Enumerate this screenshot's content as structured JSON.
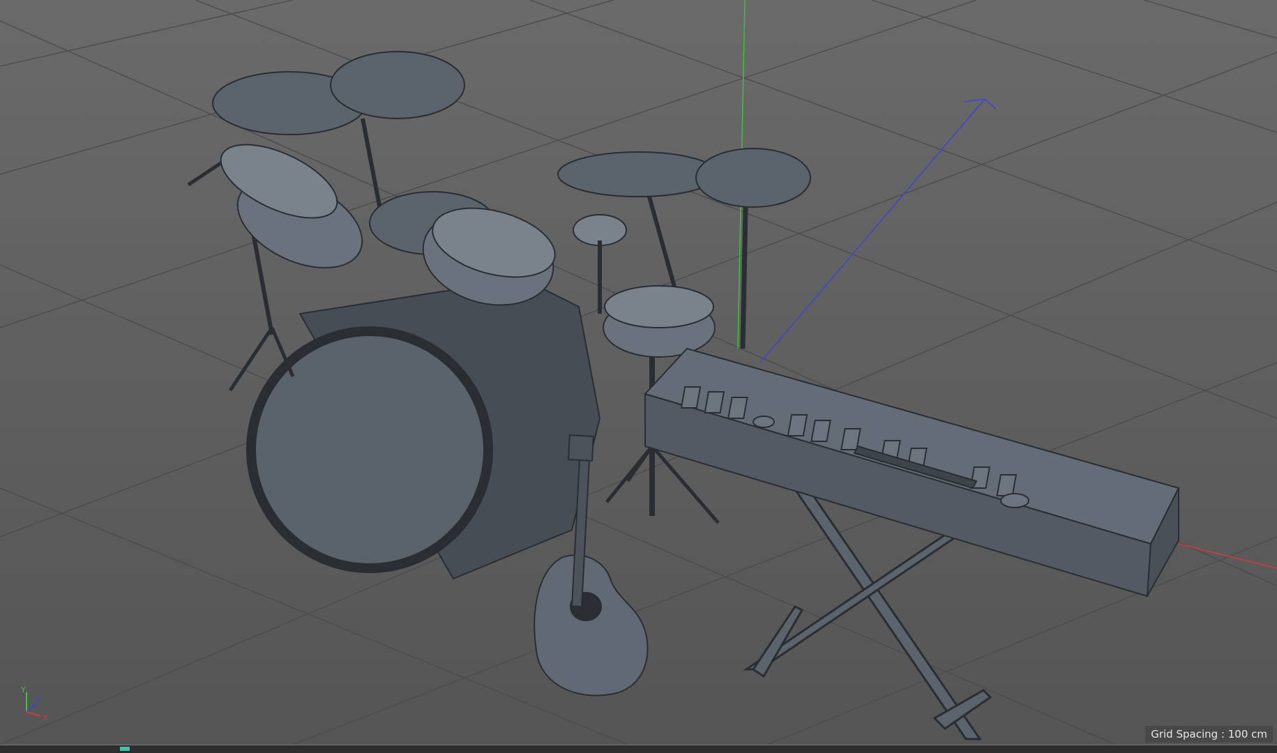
{
  "viewport": {
    "grid_spacing_label": "Grid Spacing : 100 cm"
  },
  "axis_widget": {
    "y_label": "Y",
    "z_label": "Z",
    "x_label": "X"
  },
  "scene": {
    "objects": [
      "drum-kit",
      "acoustic-guitar",
      "keyboard-synth",
      "keyboard-stand"
    ]
  },
  "colors": {
    "x_axis": "#d23b3b",
    "y_axis": "#39c339",
    "z_axis": "#3f44d6",
    "model": "#5b636c",
    "model_edge": "#2a2e33",
    "grid_line": "#4d4d4d",
    "timeline_marker": "#3ec2a8"
  }
}
